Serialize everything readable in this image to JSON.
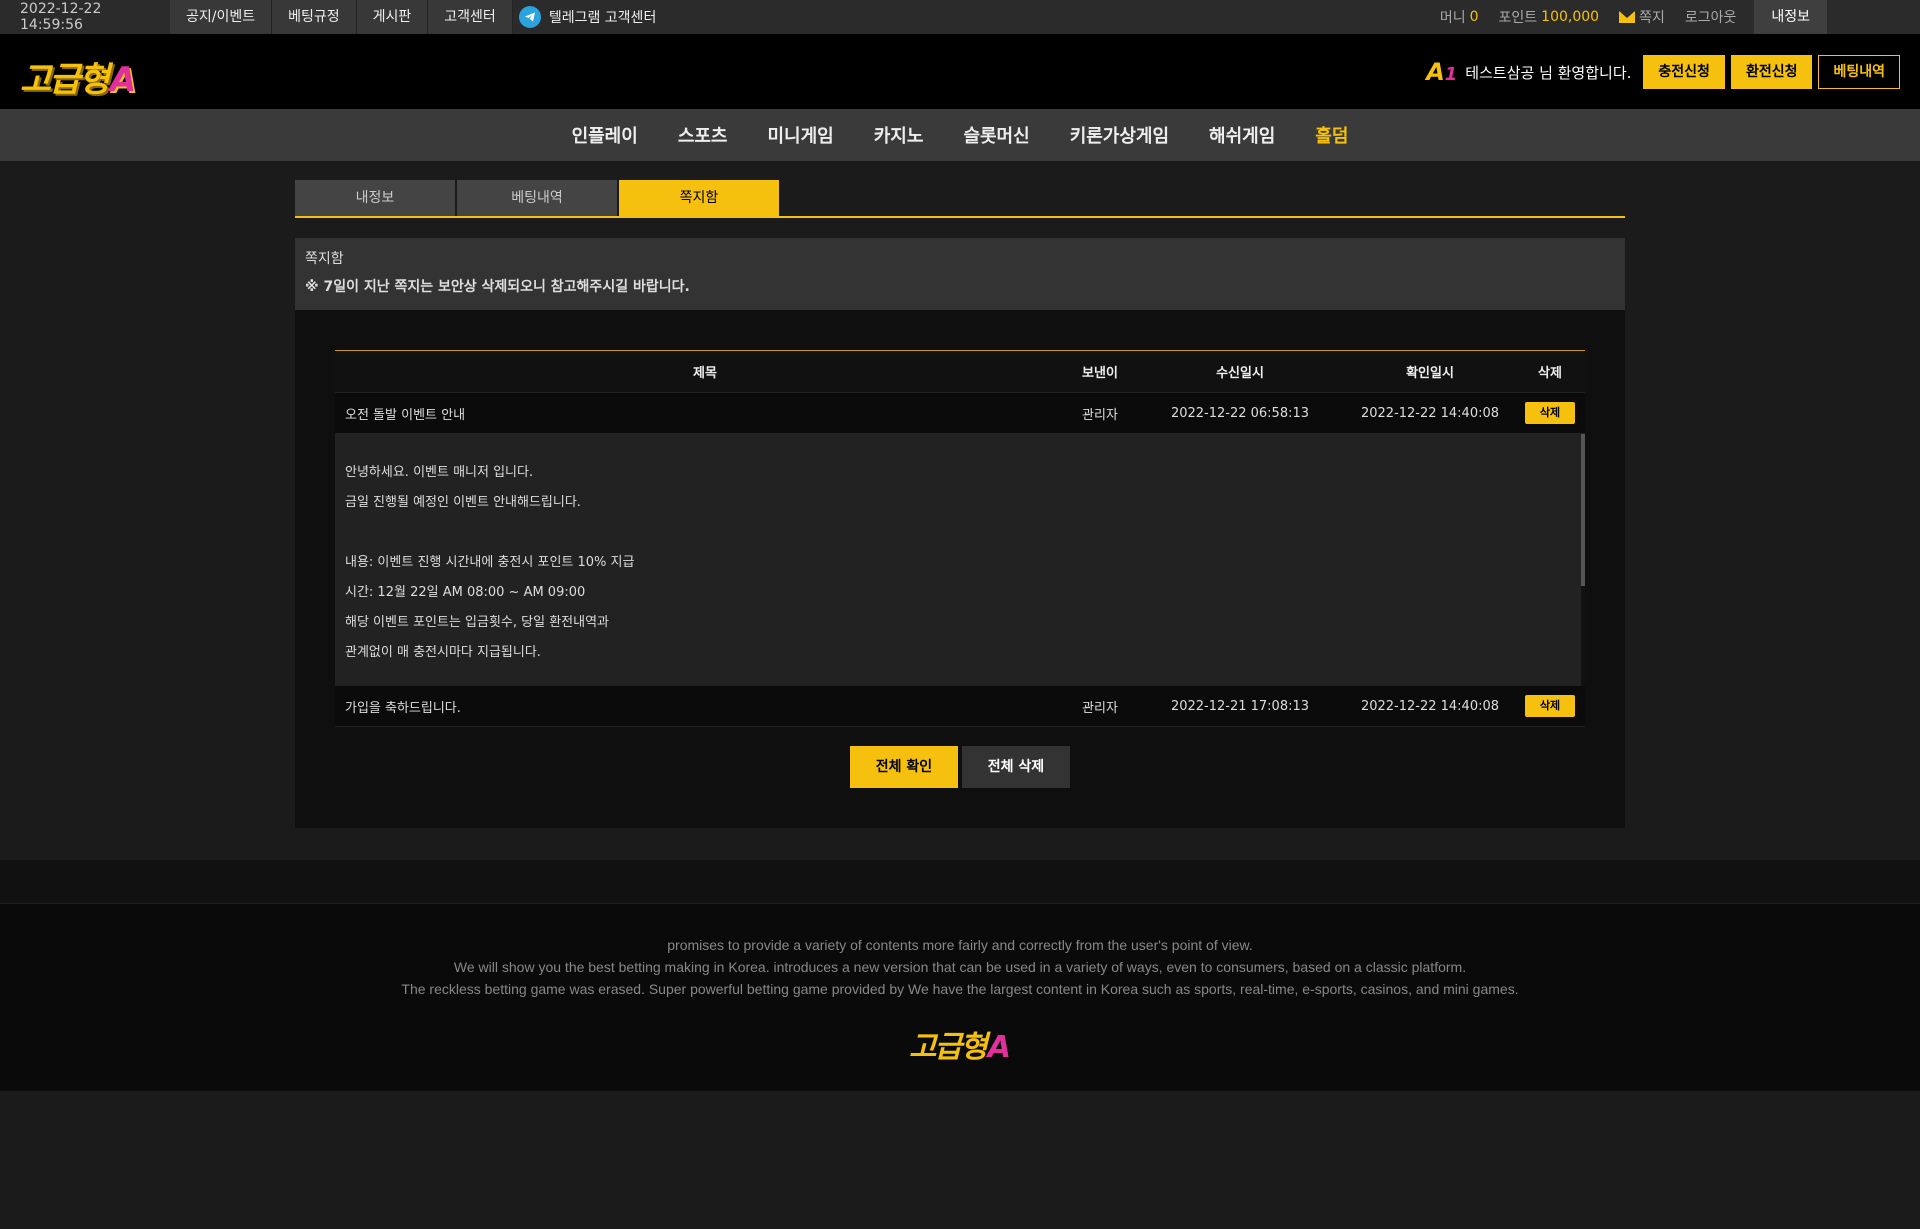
{
  "topbar": {
    "datetime": "2022-12-22 14:59:56",
    "links": [
      "공지/이벤트",
      "베팅규정",
      "게시판",
      "고객센터"
    ],
    "telegram_label": "텔레그램 고객센터",
    "money_label": "머니",
    "money_value": "0",
    "point_label": "포인트",
    "point_value": "100,000",
    "note_label": "쪽지",
    "logout_label": "로그아웃",
    "myinfo_label": "내정보"
  },
  "header": {
    "logo_text": "고급형",
    "logo_accent": "A",
    "level_badge": "A",
    "level_num": "1",
    "welcome": "테스트삼공 님 환영합니다.",
    "deposit_label": "충전신청",
    "withdraw_label": "환전신청",
    "betting_label": "베팅내역"
  },
  "nav": {
    "items": [
      "인플레이",
      "스포츠",
      "미니게임",
      "카지노",
      "슬롯머신",
      "키론가상게임",
      "해쉬게임",
      "홀덤"
    ]
  },
  "tabs": [
    "내정보",
    "베팅내역",
    "쪽지함"
  ],
  "panel": {
    "title": "쪽지함",
    "notice": "※ 7일이 지난 쪽지는 보안상 삭제되오니 참고해주시길 바랍니다."
  },
  "table": {
    "headers": {
      "title": "제목",
      "sender": "보낸이",
      "received": "수신일시",
      "confirmed": "확인일시",
      "delete": "삭제"
    },
    "rows": [
      {
        "title": "오전 돌발 이벤트 안내",
        "sender": "관리자",
        "received": "2022-12-22 06:58:13",
        "confirmed": "2022-12-22 14:40:08",
        "delete_label": "삭제"
      },
      {
        "title": "가입을 축하드립니다.",
        "sender": "관리자",
        "received": "2022-12-21 17:08:13",
        "confirmed": "2022-12-22 14:40:08",
        "delete_label": "삭제"
      }
    ],
    "message_lines": [
      "안녕하세요. 이벤트 매니저 입니다.",
      "금일 진행될 예정인 이벤트 안내해드립니다.",
      "",
      "내용: 이벤트 진행 시간내에 충전시  포인트 10% 지급",
      "시간: 12월 22일 AM 08:00 ~ AM 09:00",
      "해당 이벤트 포인트는 입금횟수, 당일 환전내역과",
      "관계없이 매 충전시마다 지급됩니다."
    ]
  },
  "actions": {
    "confirm_all": "전체 확인",
    "delete_all": "전체 삭제"
  },
  "footer": {
    "lines": [
      "promises to provide a variety of contents more fairly and correctly from the user's point of view.",
      "We will show you the best betting making in Korea. introduces a new version that can be used in a variety of ways, even to consumers, based on a classic platform.",
      "The reckless betting game was erased. Super powerful betting game provided by  We have the largest content in Korea such as sports, real-time, e-sports, casinos, and mini games."
    ],
    "logo_text": "고급형",
    "logo_accent": "A"
  },
  "colors": {
    "accent": "#f5c10e",
    "logo_pink": "#e0309a",
    "telegram": "#2aa3de"
  }
}
